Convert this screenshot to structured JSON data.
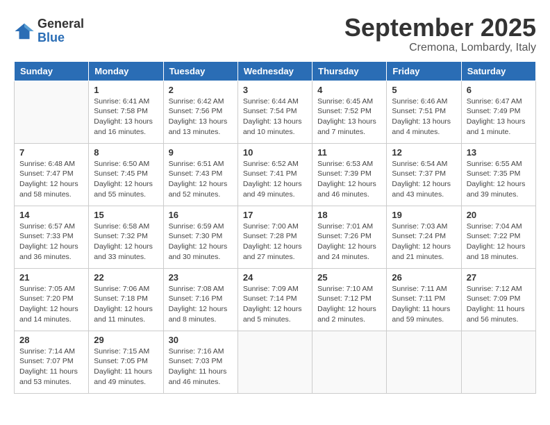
{
  "header": {
    "logo_general": "General",
    "logo_blue": "Blue",
    "month_title": "September 2025",
    "location": "Cremona, Lombardy, Italy"
  },
  "weekdays": [
    "Sunday",
    "Monday",
    "Tuesday",
    "Wednesday",
    "Thursday",
    "Friday",
    "Saturday"
  ],
  "weeks": [
    [
      {
        "day": "",
        "info": ""
      },
      {
        "day": "1",
        "info": "Sunrise: 6:41 AM\nSunset: 7:58 PM\nDaylight: 13 hours\nand 16 minutes."
      },
      {
        "day": "2",
        "info": "Sunrise: 6:42 AM\nSunset: 7:56 PM\nDaylight: 13 hours\nand 13 minutes."
      },
      {
        "day": "3",
        "info": "Sunrise: 6:44 AM\nSunset: 7:54 PM\nDaylight: 13 hours\nand 10 minutes."
      },
      {
        "day": "4",
        "info": "Sunrise: 6:45 AM\nSunset: 7:52 PM\nDaylight: 13 hours\nand 7 minutes."
      },
      {
        "day": "5",
        "info": "Sunrise: 6:46 AM\nSunset: 7:51 PM\nDaylight: 13 hours\nand 4 minutes."
      },
      {
        "day": "6",
        "info": "Sunrise: 6:47 AM\nSunset: 7:49 PM\nDaylight: 13 hours\nand 1 minute."
      }
    ],
    [
      {
        "day": "7",
        "info": "Sunrise: 6:48 AM\nSunset: 7:47 PM\nDaylight: 12 hours\nand 58 minutes."
      },
      {
        "day": "8",
        "info": "Sunrise: 6:50 AM\nSunset: 7:45 PM\nDaylight: 12 hours\nand 55 minutes."
      },
      {
        "day": "9",
        "info": "Sunrise: 6:51 AM\nSunset: 7:43 PM\nDaylight: 12 hours\nand 52 minutes."
      },
      {
        "day": "10",
        "info": "Sunrise: 6:52 AM\nSunset: 7:41 PM\nDaylight: 12 hours\nand 49 minutes."
      },
      {
        "day": "11",
        "info": "Sunrise: 6:53 AM\nSunset: 7:39 PM\nDaylight: 12 hours\nand 46 minutes."
      },
      {
        "day": "12",
        "info": "Sunrise: 6:54 AM\nSunset: 7:37 PM\nDaylight: 12 hours\nand 43 minutes."
      },
      {
        "day": "13",
        "info": "Sunrise: 6:55 AM\nSunset: 7:35 PM\nDaylight: 12 hours\nand 39 minutes."
      }
    ],
    [
      {
        "day": "14",
        "info": "Sunrise: 6:57 AM\nSunset: 7:33 PM\nDaylight: 12 hours\nand 36 minutes."
      },
      {
        "day": "15",
        "info": "Sunrise: 6:58 AM\nSunset: 7:32 PM\nDaylight: 12 hours\nand 33 minutes."
      },
      {
        "day": "16",
        "info": "Sunrise: 6:59 AM\nSunset: 7:30 PM\nDaylight: 12 hours\nand 30 minutes."
      },
      {
        "day": "17",
        "info": "Sunrise: 7:00 AM\nSunset: 7:28 PM\nDaylight: 12 hours\nand 27 minutes."
      },
      {
        "day": "18",
        "info": "Sunrise: 7:01 AM\nSunset: 7:26 PM\nDaylight: 12 hours\nand 24 minutes."
      },
      {
        "day": "19",
        "info": "Sunrise: 7:03 AM\nSunset: 7:24 PM\nDaylight: 12 hours\nand 21 minutes."
      },
      {
        "day": "20",
        "info": "Sunrise: 7:04 AM\nSunset: 7:22 PM\nDaylight: 12 hours\nand 18 minutes."
      }
    ],
    [
      {
        "day": "21",
        "info": "Sunrise: 7:05 AM\nSunset: 7:20 PM\nDaylight: 12 hours\nand 14 minutes."
      },
      {
        "day": "22",
        "info": "Sunrise: 7:06 AM\nSunset: 7:18 PM\nDaylight: 12 hours\nand 11 minutes."
      },
      {
        "day": "23",
        "info": "Sunrise: 7:08 AM\nSunset: 7:16 PM\nDaylight: 12 hours\nand 8 minutes."
      },
      {
        "day": "24",
        "info": "Sunrise: 7:09 AM\nSunset: 7:14 PM\nDaylight: 12 hours\nand 5 minutes."
      },
      {
        "day": "25",
        "info": "Sunrise: 7:10 AM\nSunset: 7:12 PM\nDaylight: 12 hours\nand 2 minutes."
      },
      {
        "day": "26",
        "info": "Sunrise: 7:11 AM\nSunset: 7:11 PM\nDaylight: 11 hours\nand 59 minutes."
      },
      {
        "day": "27",
        "info": "Sunrise: 7:12 AM\nSunset: 7:09 PM\nDaylight: 11 hours\nand 56 minutes."
      }
    ],
    [
      {
        "day": "28",
        "info": "Sunrise: 7:14 AM\nSunset: 7:07 PM\nDaylight: 11 hours\nand 53 minutes."
      },
      {
        "day": "29",
        "info": "Sunrise: 7:15 AM\nSunset: 7:05 PM\nDaylight: 11 hours\nand 49 minutes."
      },
      {
        "day": "30",
        "info": "Sunrise: 7:16 AM\nSunset: 7:03 PM\nDaylight: 11 hours\nand 46 minutes."
      },
      {
        "day": "",
        "info": ""
      },
      {
        "day": "",
        "info": ""
      },
      {
        "day": "",
        "info": ""
      },
      {
        "day": "",
        "info": ""
      }
    ]
  ]
}
